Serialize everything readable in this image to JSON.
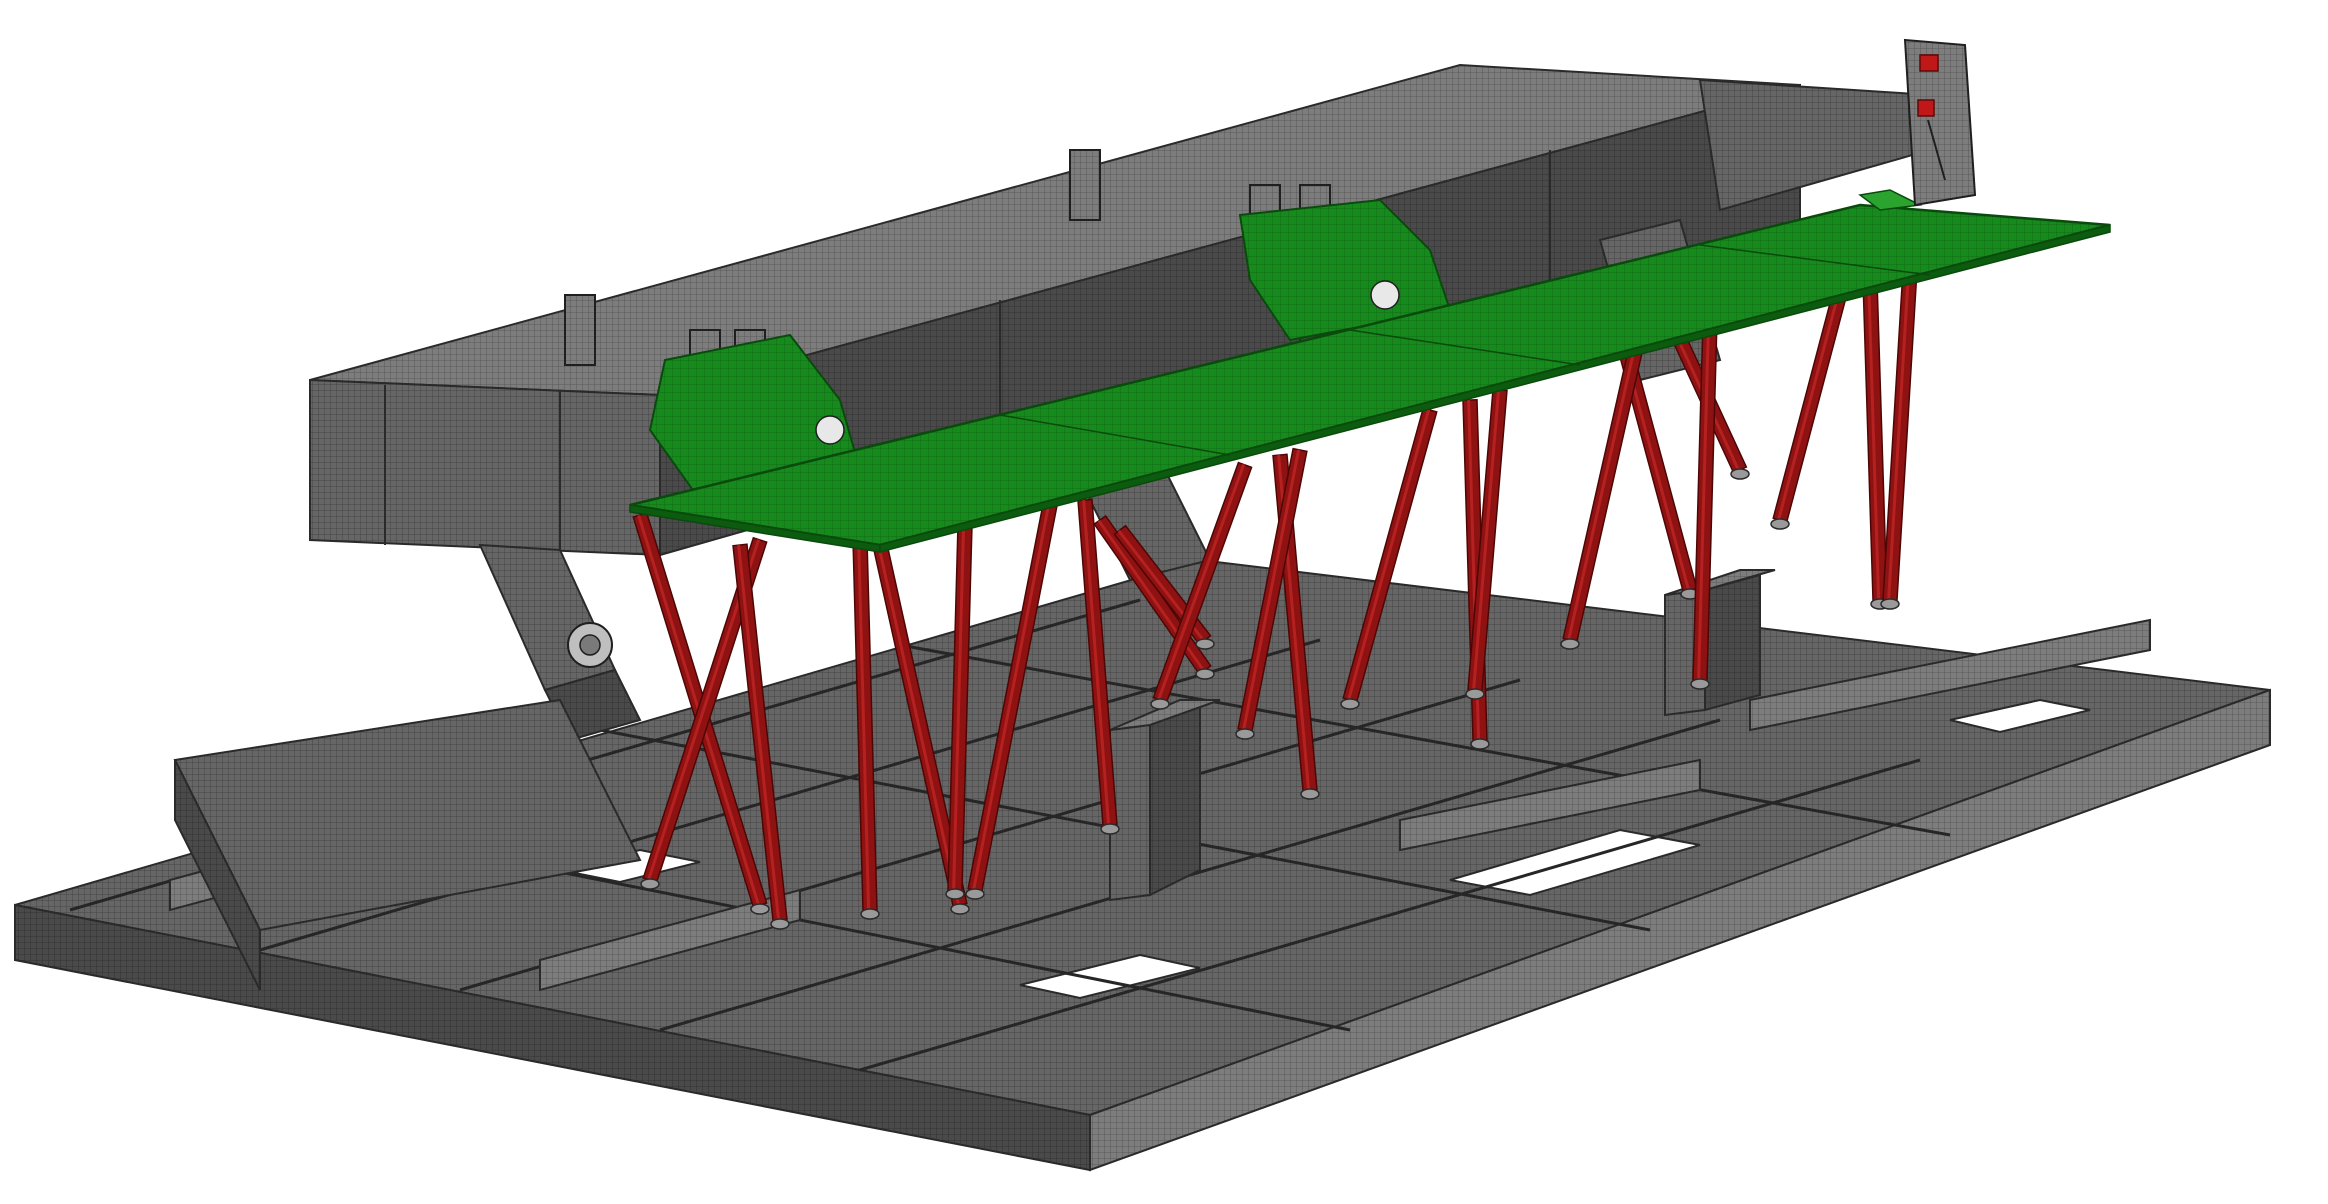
{
  "scene": {
    "kind": "finite-element mesh render of a steel support structure",
    "colors": {
      "background": "#ffffff",
      "mesh_gray": "#5a5a5a",
      "mesh_gray_light": "#7a7a7a",
      "mesh_gray_dark": "#3d3d3d",
      "deck_green": "#14801a",
      "deck_green_dark": "#0c5c10",
      "strut_red": "#8b1010",
      "strut_red_dark": "#5e0808",
      "accent_red": "#c01818"
    },
    "components": [
      "base-frame",
      "upper-beam",
      "green-deck",
      "red-struts",
      "gray-pedestals",
      "end-bracket"
    ]
  }
}
